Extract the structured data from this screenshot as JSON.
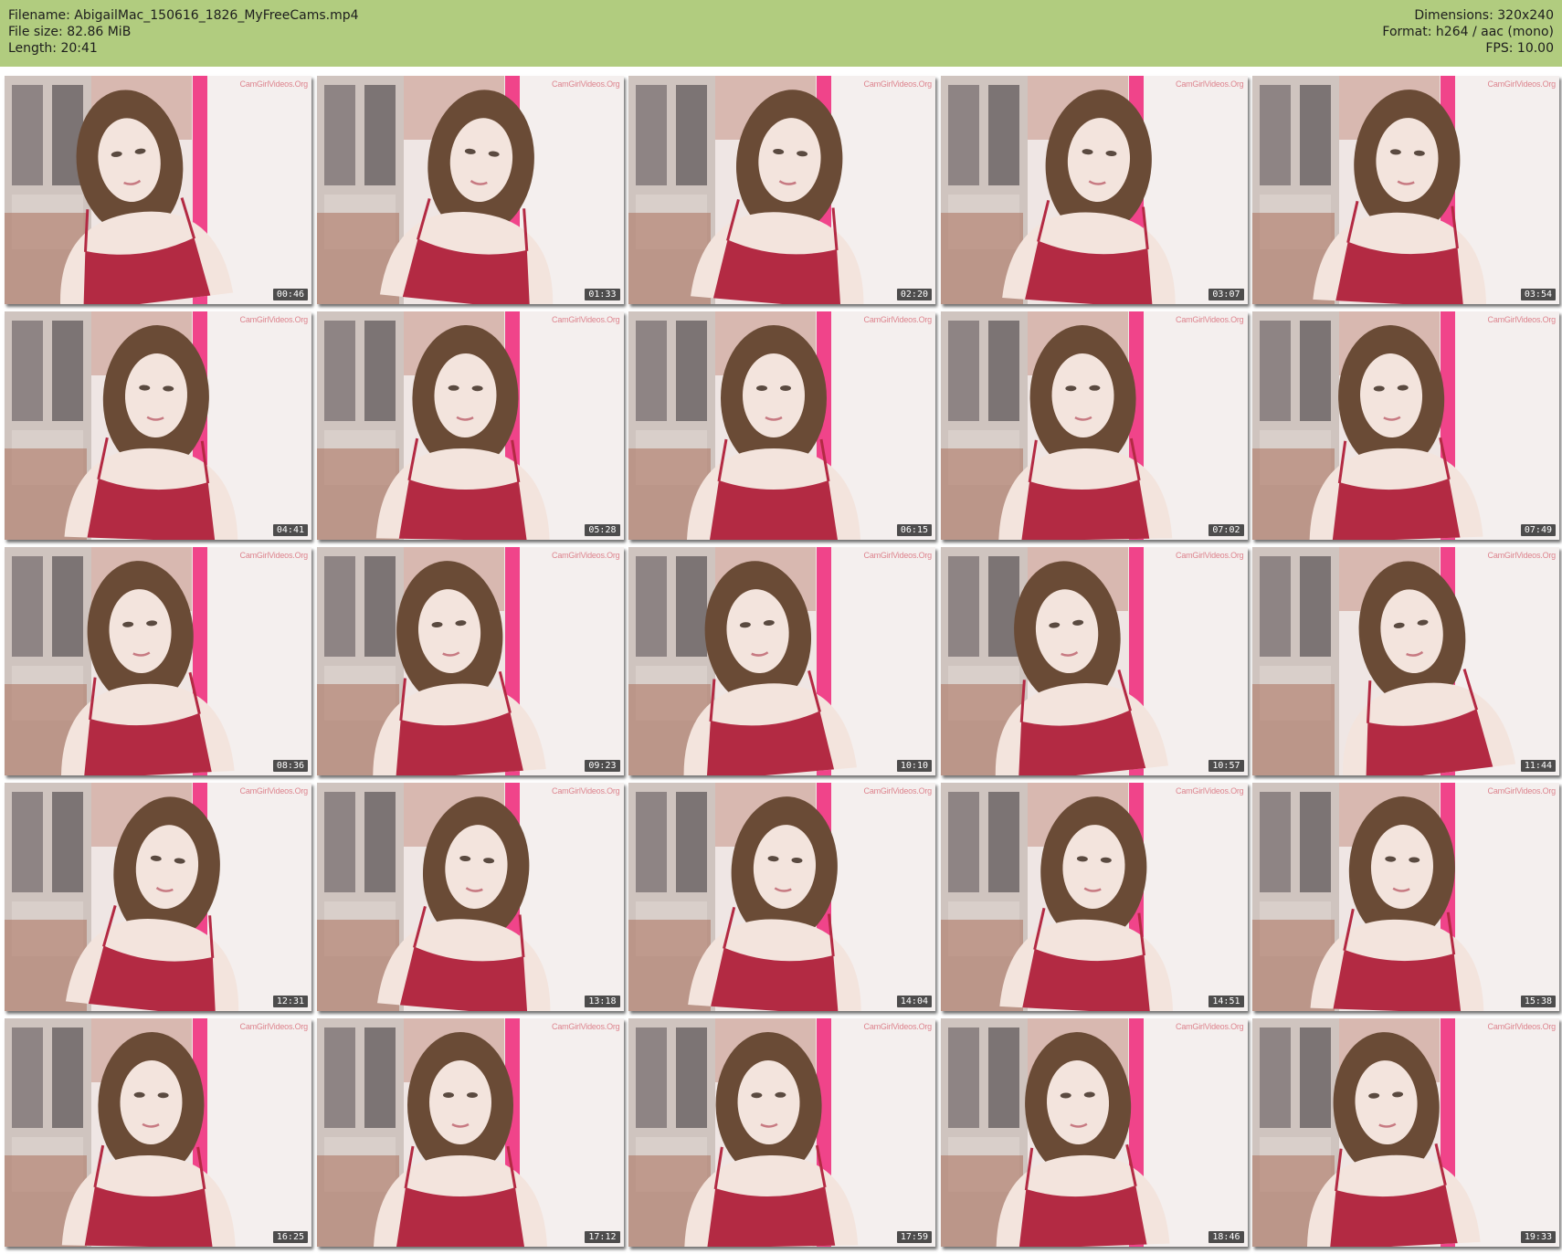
{
  "header": {
    "filename": "Filename: AbigailMac_150616_1826_MyFreeCams.mp4",
    "filesize": "File size: 82.86 MiB",
    "length": "Length: 20:41",
    "dimensions": "Dimensions: 320x240",
    "format": "Format: h264 / aac (mono)",
    "fps": "FPS: 10.00"
  },
  "watermark": "CamGirlVideos.Org",
  "thumbnails": [
    "00:46",
    "01:33",
    "02:20",
    "03:07",
    "03:54",
    "04:41",
    "05:28",
    "06:15",
    "07:02",
    "07:49",
    "08:36",
    "09:23",
    "10:10",
    "10:57",
    "11:44",
    "12:31",
    "13:18",
    "14:04",
    "14:51",
    "15:38",
    "16:25",
    "17:12",
    "17:59",
    "18:46",
    "19:33"
  ],
  "colors": {
    "header_bg": "#b1cc7f",
    "wall": "#efe6e4",
    "cabinet": "#cfc4bf",
    "feather_boa": "#f0448a",
    "dress": "#b32a43",
    "hair": "#6a4b36",
    "skin": "#f3e4dd"
  }
}
